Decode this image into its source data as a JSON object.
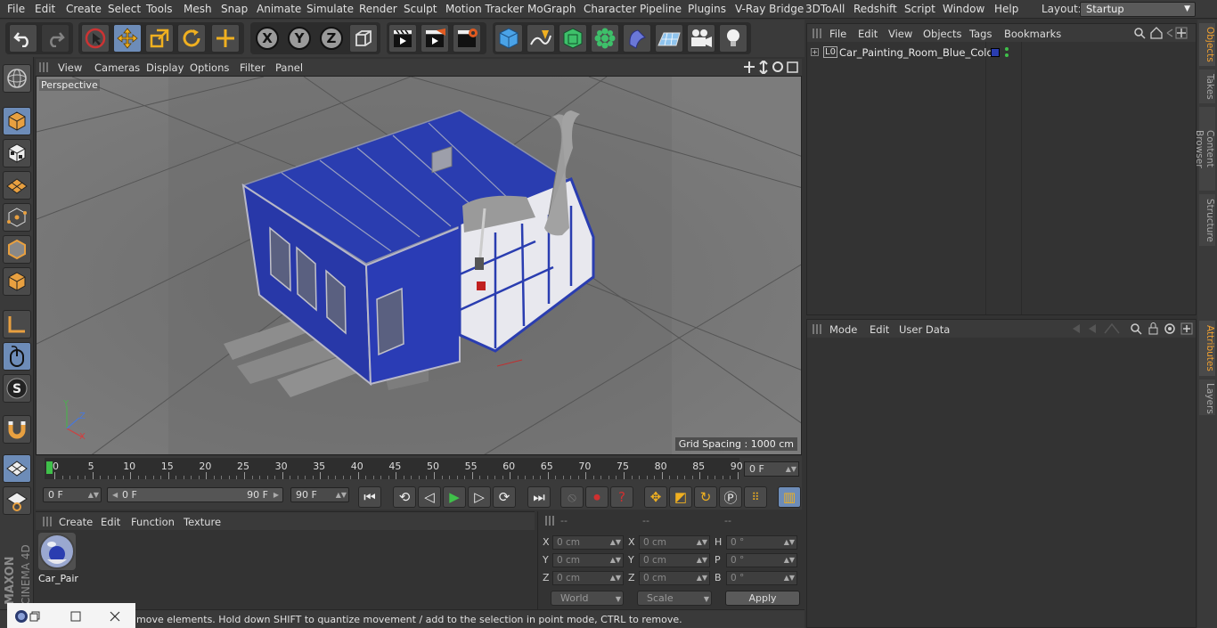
{
  "menubar": {
    "items": [
      "File",
      "Edit",
      "Create",
      "Select",
      "Tools",
      "Mesh",
      "Snap",
      "Animate",
      "Simulate",
      "Render",
      "Sculpt",
      "Motion Tracker",
      "MoGraph",
      "Character",
      "Pipeline",
      "Plugins",
      "V-Ray Bridge",
      "3DToAll",
      "Redshift",
      "Script",
      "Window",
      "Help"
    ],
    "layout_label": "Layout:",
    "layout_value": "Startup"
  },
  "toolbar": {
    "axis_x": "X",
    "axis_y": "Y",
    "axis_z": "Z"
  },
  "viewport": {
    "menu": [
      "View",
      "Cameras",
      "Display",
      "Options",
      "Filter",
      "Panel"
    ],
    "camera_label": "Perspective",
    "grid_spacing": "Grid Spacing : 1000 cm"
  },
  "timeline": {
    "ticks": [
      "0",
      "5",
      "10",
      "15",
      "20",
      "25",
      "30",
      "35",
      "40",
      "45",
      "50",
      "55",
      "60",
      "65",
      "70",
      "75",
      "80",
      "85",
      "90"
    ],
    "current_frame": "0 F"
  },
  "transport": {
    "start_frame": "0 F",
    "range_start": "0 F",
    "range_end": "90 F",
    "end_frame": "90 F"
  },
  "materials": {
    "menu": [
      "Create",
      "Edit",
      "Function",
      "Texture"
    ],
    "items": [
      {
        "name": "Car_Pair"
      }
    ]
  },
  "coordinates": {
    "headers": [
      "--",
      "--",
      "--"
    ],
    "rows": [
      {
        "l1": "X",
        "v1": "0 cm",
        "l2": "X",
        "v2": "0 cm",
        "l3": "H",
        "v3": "0 °"
      },
      {
        "l1": "Y",
        "v1": "0 cm",
        "l2": "Y",
        "v2": "0 cm",
        "l3": "P",
        "v3": "0 °"
      },
      {
        "l1": "Z",
        "v1": "0 cm",
        "l2": "Z",
        "v2": "0 cm",
        "l3": "B",
        "v3": "0 °"
      }
    ],
    "mode_dropdown": "World",
    "scale_dropdown": "Scale",
    "apply_label": "Apply"
  },
  "status": {
    "text": "move elements. Hold down SHIFT to quantize movement / add to the selection in point mode, CTRL to remove."
  },
  "objects_panel": {
    "menu": [
      "File",
      "Edit",
      "View",
      "Objects",
      "Tags",
      "Bookmarks"
    ],
    "object_name": "Car_Painting_Room_Blue_Color",
    "layer_tag": "L0"
  },
  "attributes_panel": {
    "menu": [
      "Mode",
      "Edit",
      "User Data"
    ]
  },
  "right_tabs": [
    "Objects",
    "Takes",
    "Content Browser",
    "Structure"
  ],
  "right_tabs_lower": [
    "Attributes",
    "Layers"
  ],
  "branding": {
    "maxon": "MAXON",
    "product": "CINEMA 4D"
  },
  "colors": {
    "accent": "#6d8cb8",
    "booth_blue": "#2a3db0",
    "play_green": "#3fc04a",
    "tab_active": "#f0a030"
  }
}
